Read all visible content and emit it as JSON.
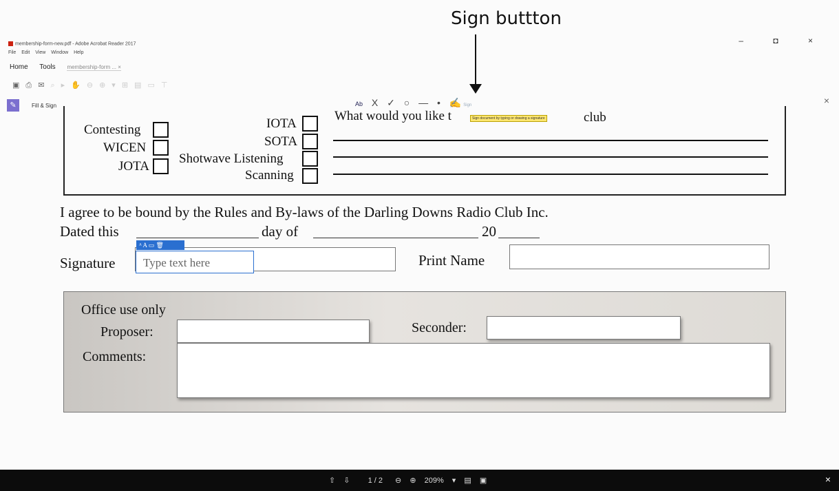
{
  "annotation": {
    "label": "Sign buttton"
  },
  "window": {
    "title": "membership-form-new.pdf - Adobe Acrobat Reader 2017",
    "controls": "– ◘ ×"
  },
  "menu": [
    "File",
    "Edit",
    "View",
    "Window",
    "Help"
  ],
  "tabs": {
    "home": "Home",
    "tools": "Tools",
    "document": "membership-form ... ×"
  },
  "toolbar_icons": [
    "save-icon",
    "print-icon",
    "email-icon",
    "search-icon",
    "select-icon",
    "hand-icon",
    "zoom-out-icon",
    "zoom-in-icon",
    "zoom-level-icon",
    "fit-icon",
    "page-icon",
    "comment-icon",
    "highlight-icon"
  ],
  "fill_sign": {
    "panel_label": "Fill & Sign",
    "tools": {
      "text": "Ab",
      "cross": "X",
      "check": "✓",
      "circle": "○",
      "line": "—",
      "dot": "•",
      "sign_icon": "✍",
      "sign_label": "Sign"
    },
    "tooltip": "Sign document by typing or drawing a signature"
  },
  "form": {
    "left_items": [
      "Contesting",
      "WICEN",
      "JOTA"
    ],
    "mid_items": [
      "IOTA",
      "SOTA",
      "Shotwave Listening",
      "Scanning"
    ],
    "question": "What would you like t",
    "question_end": "club",
    "agree_text": "I agree to be bound by the Rules and By-laws of the Darling Downs Radio Club Inc.",
    "dated_this": "Dated this",
    "day_of": "day of",
    "year_prefix": "20",
    "signature_label": "Signature",
    "print_name_label": "Print Name",
    "textbox_placeholder": "Type text here",
    "office": {
      "title": "Office use only",
      "proposer": "Proposer:",
      "seconder": "Seconder:",
      "comments": "Comments:"
    }
  },
  "bottombar": {
    "page": "1 / 2",
    "zoom": "209%"
  }
}
